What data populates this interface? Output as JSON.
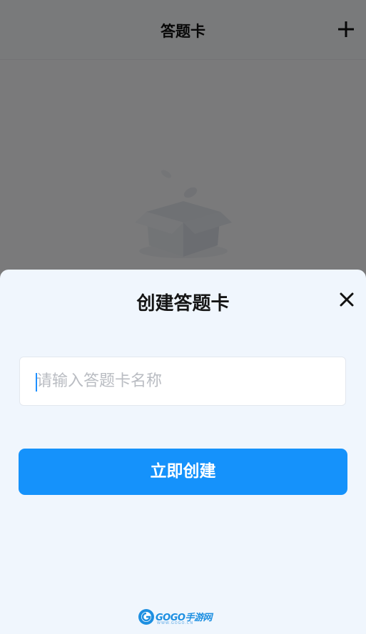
{
  "navbar": {
    "title": "答题卡",
    "add_icon": "plus-icon"
  },
  "empty_state": {
    "illustration": "empty-box-icon"
  },
  "sheet": {
    "title": "创建答题卡",
    "close_icon": "close-icon",
    "name_input": {
      "value": "",
      "placeholder": "请输入答题卡名称"
    },
    "create_button_label": "立即创建"
  },
  "watermark": {
    "logo": "gogo-logo",
    "text": "GOGO手游网",
    "sub": "WWW.GOGO.CN"
  },
  "colors": {
    "accent": "#1592fb",
    "sheet_bg": "#f0f6fd",
    "mask": "rgba(0,0,0,0.5)"
  }
}
